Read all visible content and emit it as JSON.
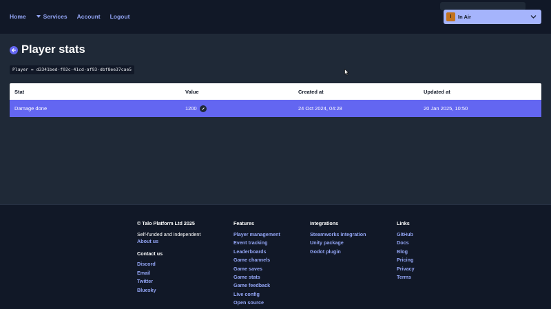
{
  "nav": {
    "home": "Home",
    "services": "Services",
    "account": "Account",
    "logout": "Logout",
    "game": {
      "initial": "I",
      "name": "In Air"
    }
  },
  "page": {
    "title": "Player stats",
    "player_badge": "Player = d3341bed-f02c-41cd-af93-dbf8ee37cae5"
  },
  "table": {
    "headers": [
      "Stat",
      "Value",
      "Created at",
      "Updated at"
    ],
    "rows": [
      {
        "stat": "Damage done",
        "value": "1200",
        "created_at": "24 Oct 2024, 04:28",
        "updated_at": "20 Jan 2025, 10:50"
      }
    ]
  },
  "footer": {
    "company": "© Talo Platform Ltd 2025",
    "tagline": "Self-funded and independent",
    "about": "About us",
    "contact_heading": "Contact us",
    "contact": [
      "Discord",
      "Email",
      "Twitter",
      "Bluesky"
    ],
    "features_heading": "Features",
    "features": [
      "Player management",
      "Event tracking",
      "Leaderboards",
      "Game channels",
      "Game saves",
      "Game stats",
      "Game feedback",
      "Live config",
      "Open source"
    ],
    "integrations_heading": "Integrations",
    "integrations": [
      "Steamworks integration",
      "Unity package",
      "Godot plugin"
    ],
    "links_heading": "Links",
    "links": [
      "GitHub",
      "Docs",
      "Blog",
      "Pricing",
      "Privacy",
      "Terms"
    ]
  },
  "colors": {
    "accent": "#6366f1",
    "link": "#93a5f5",
    "nav_bg": "#111827",
    "page_bg": "#1f2937",
    "game_select_bg": "#a5b4fc"
  },
  "icons": {
    "back": "arrow-left-icon",
    "edit": "pencil-icon",
    "game_chevron": "chevron-down-icon",
    "services_caret": "caret-down-icon"
  }
}
